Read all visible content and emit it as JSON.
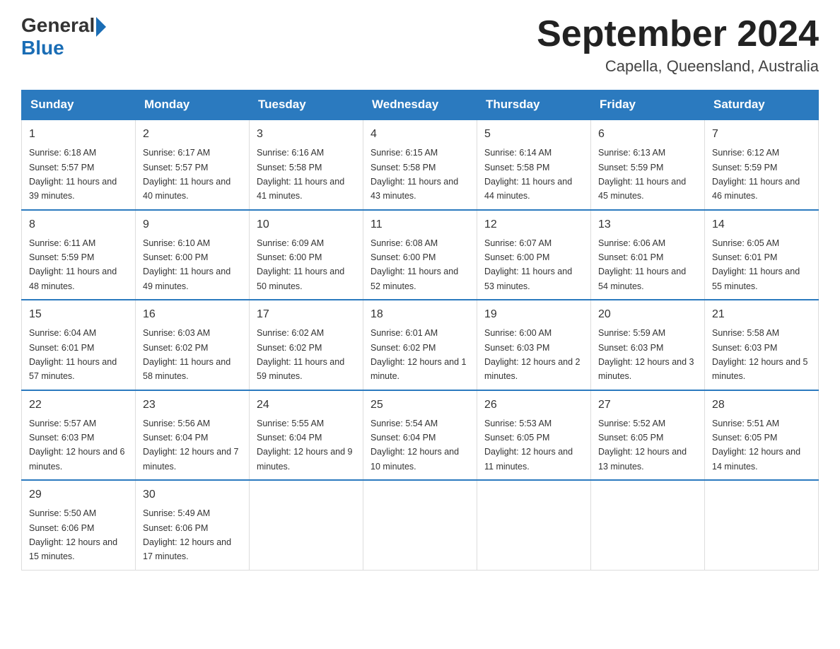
{
  "header": {
    "logo_general": "General",
    "logo_blue": "Blue",
    "month_year": "September 2024",
    "location": "Capella, Queensland, Australia"
  },
  "days_of_week": [
    "Sunday",
    "Monday",
    "Tuesday",
    "Wednesday",
    "Thursday",
    "Friday",
    "Saturday"
  ],
  "weeks": [
    [
      {
        "day": "1",
        "sunrise": "6:18 AM",
        "sunset": "5:57 PM",
        "daylight": "11 hours and 39 minutes."
      },
      {
        "day": "2",
        "sunrise": "6:17 AM",
        "sunset": "5:57 PM",
        "daylight": "11 hours and 40 minutes."
      },
      {
        "day": "3",
        "sunrise": "6:16 AM",
        "sunset": "5:58 PM",
        "daylight": "11 hours and 41 minutes."
      },
      {
        "day": "4",
        "sunrise": "6:15 AM",
        "sunset": "5:58 PM",
        "daylight": "11 hours and 43 minutes."
      },
      {
        "day": "5",
        "sunrise": "6:14 AM",
        "sunset": "5:58 PM",
        "daylight": "11 hours and 44 minutes."
      },
      {
        "day": "6",
        "sunrise": "6:13 AM",
        "sunset": "5:59 PM",
        "daylight": "11 hours and 45 minutes."
      },
      {
        "day": "7",
        "sunrise": "6:12 AM",
        "sunset": "5:59 PM",
        "daylight": "11 hours and 46 minutes."
      }
    ],
    [
      {
        "day": "8",
        "sunrise": "6:11 AM",
        "sunset": "5:59 PM",
        "daylight": "11 hours and 48 minutes."
      },
      {
        "day": "9",
        "sunrise": "6:10 AM",
        "sunset": "6:00 PM",
        "daylight": "11 hours and 49 minutes."
      },
      {
        "day": "10",
        "sunrise": "6:09 AM",
        "sunset": "6:00 PM",
        "daylight": "11 hours and 50 minutes."
      },
      {
        "day": "11",
        "sunrise": "6:08 AM",
        "sunset": "6:00 PM",
        "daylight": "11 hours and 52 minutes."
      },
      {
        "day": "12",
        "sunrise": "6:07 AM",
        "sunset": "6:00 PM",
        "daylight": "11 hours and 53 minutes."
      },
      {
        "day": "13",
        "sunrise": "6:06 AM",
        "sunset": "6:01 PM",
        "daylight": "11 hours and 54 minutes."
      },
      {
        "day": "14",
        "sunrise": "6:05 AM",
        "sunset": "6:01 PM",
        "daylight": "11 hours and 55 minutes."
      }
    ],
    [
      {
        "day": "15",
        "sunrise": "6:04 AM",
        "sunset": "6:01 PM",
        "daylight": "11 hours and 57 minutes."
      },
      {
        "day": "16",
        "sunrise": "6:03 AM",
        "sunset": "6:02 PM",
        "daylight": "11 hours and 58 minutes."
      },
      {
        "day": "17",
        "sunrise": "6:02 AM",
        "sunset": "6:02 PM",
        "daylight": "11 hours and 59 minutes."
      },
      {
        "day": "18",
        "sunrise": "6:01 AM",
        "sunset": "6:02 PM",
        "daylight": "12 hours and 1 minute."
      },
      {
        "day": "19",
        "sunrise": "6:00 AM",
        "sunset": "6:03 PM",
        "daylight": "12 hours and 2 minutes."
      },
      {
        "day": "20",
        "sunrise": "5:59 AM",
        "sunset": "6:03 PM",
        "daylight": "12 hours and 3 minutes."
      },
      {
        "day": "21",
        "sunrise": "5:58 AM",
        "sunset": "6:03 PM",
        "daylight": "12 hours and 5 minutes."
      }
    ],
    [
      {
        "day": "22",
        "sunrise": "5:57 AM",
        "sunset": "6:03 PM",
        "daylight": "12 hours and 6 minutes."
      },
      {
        "day": "23",
        "sunrise": "5:56 AM",
        "sunset": "6:04 PM",
        "daylight": "12 hours and 7 minutes."
      },
      {
        "day": "24",
        "sunrise": "5:55 AM",
        "sunset": "6:04 PM",
        "daylight": "12 hours and 9 minutes."
      },
      {
        "day": "25",
        "sunrise": "5:54 AM",
        "sunset": "6:04 PM",
        "daylight": "12 hours and 10 minutes."
      },
      {
        "day": "26",
        "sunrise": "5:53 AM",
        "sunset": "6:05 PM",
        "daylight": "12 hours and 11 minutes."
      },
      {
        "day": "27",
        "sunrise": "5:52 AM",
        "sunset": "6:05 PM",
        "daylight": "12 hours and 13 minutes."
      },
      {
        "day": "28",
        "sunrise": "5:51 AM",
        "sunset": "6:05 PM",
        "daylight": "12 hours and 14 minutes."
      }
    ],
    [
      {
        "day": "29",
        "sunrise": "5:50 AM",
        "sunset": "6:06 PM",
        "daylight": "12 hours and 15 minutes."
      },
      {
        "day": "30",
        "sunrise": "5:49 AM",
        "sunset": "6:06 PM",
        "daylight": "12 hours and 17 minutes."
      },
      null,
      null,
      null,
      null,
      null
    ]
  ]
}
